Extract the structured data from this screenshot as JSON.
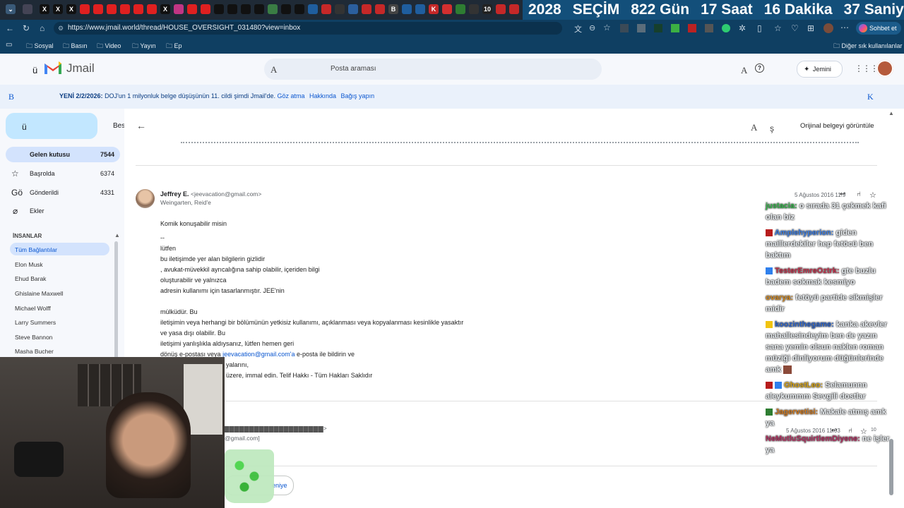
{
  "browser": {
    "url": "https://www.jmail.world/thread/HOUSE_OVERSIGHT_031480?view=inbox",
    "bookmarks": [
      "Sosyal",
      "Basın",
      "Video",
      "Yayın",
      "Ep"
    ],
    "other_bookmarks": "Diğer sık kullanılanlar",
    "chat_button": "Sohbet et",
    "tab_glyphs": [
      "X",
      "X",
      "X",
      "X",
      "B",
      "K",
      "10"
    ]
  },
  "countdown": {
    "year": "2028",
    "label": "SEÇİM",
    "days": "822 Gün",
    "hours": "17 Saat",
    "minutes": "16 Dakika",
    "seconds": "37 Saniye"
  },
  "app": {
    "name": "Jmail",
    "search_placeholder": "Posta araması",
    "gemini_label": "Jemini",
    "glyph_menu": "ü",
    "glyph_search": "A",
    "glyph_tune": "A"
  },
  "banner": {
    "icon_glyph": "B",
    "prefix": "YENİ 2/2/2026:",
    "text": "DOJ'un 1 milyonluk belge düşüşünün 11. cildi şimdi Jmail'de.",
    "dismiss": "Göz atma",
    "about": "Hakkında",
    "donate": "Bağış yapın",
    "close_glyph": "K"
  },
  "sidebar": {
    "compose_glyph": "ü",
    "compose_label": "Bes",
    "items": [
      {
        "label": "Gelen kutusu",
        "count": "7544"
      },
      {
        "label": "Başrolda",
        "count": "6374"
      },
      {
        "label": "Gönderildi",
        "count": "4331"
      },
      {
        "label": "Ekler",
        "count": ""
      }
    ],
    "sent_glyph": "Gö",
    "section_title": "İNSANLAR",
    "contacts": [
      "Tüm Bağlantılar",
      "Elon Musk",
      "Ehud Barak",
      "Ghislaine Maxwell",
      "Michael Wolff",
      "Larry Summers",
      "Steve Bannon",
      "Masha Bucher"
    ]
  },
  "thread": {
    "view_original": "Orijinal belgeyi görüntüle",
    "toolbar_glyph_a": "A",
    "toolbar_glyph_b": "ş",
    "sender_name": "Jeffrey E.",
    "sender_email": "<jeevacation@gmail.com>",
    "recipient": "Weingarten, Reid'e",
    "date": "5 Ağustos 2016 11:9",
    "body_lines": [
      "Komik konuşabilir misin",
      "--",
      "lütfen",
      "bu iletişimde yer alan bilgilerin gizlidir",
      ", avukat-müvekkil ayrıcalığına sahip olabilir, içeriden bilgi",
      "oluşturabilir ve yalnızca",
      "adresin kullanımı için tasarlanmıştır. JEE'nin",
      "",
      "mülküdür. Bu",
      "iletişimin veya herhangi bir bölümünün yetkisiz kullanımı, açıklanması veya kopyalanması kesinlikle yasaktır",
      "ve yasa dışı olabilir. Bu",
      "iletişimi yanlışlıkla aldıysanız, lütfen hemen geri",
      "dönüş e-postası veya",
      "yalarını,",
      "üzere, immal edin. Telif Hakkı - Tüm Hakları Saklıdır"
    ],
    "reply_link": "jeevacation@gmail.com'a",
    "reply_suffix": "e-posta ile bildirin ve",
    "second_email_tail": "@gmail.com]",
    "second_date": "5 Ağustos 2016 11:03",
    "second_count": "10",
    "reply_button": "eniye"
  },
  "chat": [
    {
      "user": "justacia:",
      "text": "o sırada 31 çekmek kafi olan biz",
      "color": "#33b54a"
    },
    {
      "user": "Amplehyperion:",
      "text": "giden maillerdekiler hep fetöcü ben baktım",
      "color": "#3c7de0"
    },
    {
      "user": "TesterEmreOztrk:",
      "text": "gte buzlu badem sokmak kesmiyo",
      "color": "#c0304a"
    },
    {
      "user": "ovarya:",
      "text": "fetöyü partide sikmişler midir",
      "color": "#d28a24"
    },
    {
      "user": "koozinthegame:",
      "text": "kanka akevler mahallesindeyim ben de yazın sana yemin olsun naklen roman müziği dinliyorum düğünlerinde amk",
      "color": "#2a62c9"
    },
    {
      "user": "GhostLeo:",
      "text": "Selamunnn aleykummm Sevgili dostlar",
      "color": "#d6a315"
    },
    {
      "user": "Jagervetisi:",
      "text": "Makale atmış amk ya",
      "color": "#d0781c"
    },
    {
      "user": "NeMutluSquirtlemDiyene:",
      "text": "ne işler ya",
      "color": "#b03060"
    }
  ],
  "colors": {
    "accent": "#0b57d0",
    "selected_nav": "#d3e3fd",
    "banner_bg": "#eaf1fb",
    "browser_bar": "#0f3f62"
  }
}
